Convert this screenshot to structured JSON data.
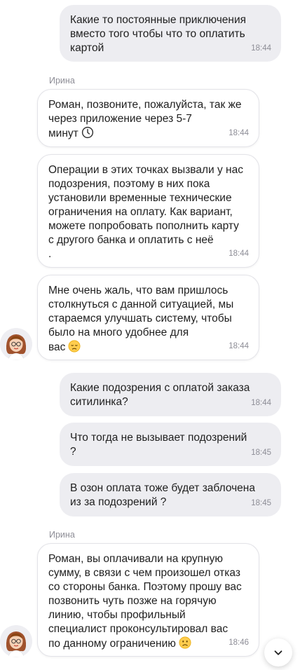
{
  "messages": [
    {
      "from": "me",
      "text": "Какие то постоянные приключения\nвместо того чтобы что то оплатить\nкартой",
      "time": "18:44"
    },
    {
      "from": "Ирина",
      "sender": "Ирина",
      "text": "Роман, позвоните, пожалуйста, так же\nчерез приложение через 5-7\nминут",
      "time": "18:44"
    },
    {
      "from": "Ирина",
      "text": "Операции в этих точках вызвали у нас\nподозрения, поэтому в них пока\nустановили временные технические\nограничения на оплату. Как вариант,\nможете попробовать пополнить карту\nс другого банка и оплатить с неё\n.",
      "time": "18:44"
    },
    {
      "from": "Ирина",
      "text": "Мне очень жаль, что вам пришлось\nстолкнуться с данной ситуацией, мы\nстараемся улучшать систему, чтобы\nбыло на много удобнее для\nвас",
      "time": "18:44"
    },
    {
      "from": "me",
      "text": "Какие подозрения с оплатой заказа\nситилинка?",
      "time": "18:44"
    },
    {
      "from": "me",
      "text": "Что тогда не вызывает подозрений\n?",
      "time": "18:45"
    },
    {
      "from": "me",
      "text": "В озон оплата тоже будет заблочена\nиз за подозрений ?",
      "time": "18:45"
    },
    {
      "from": "Ирина",
      "sender": "Ирина",
      "text": "Роман, вы оплачивали на крупную\nсумму, в связи с чем произошел отказ\nсо стороны банка. Поэтому прошу вас\nпозвонить чуть позже на горячую\nлинию, чтобы профильный\nспециалист проконсультировал вас\nпо данному ограничению",
      "time": "18:46"
    }
  ],
  "icons": {
    "clock": "clock-icon",
    "sad_emoji": "disappointed-face-emoji",
    "frown_emoji": "frowning-face-emoji",
    "scroll_down": "chevron-down-icon",
    "avatar": "operator-avatar"
  },
  "colors": {
    "outgoing_bubble": "#ededf1",
    "incoming_bubble": "#ffffff",
    "timestamp": "#8d8d96"
  }
}
